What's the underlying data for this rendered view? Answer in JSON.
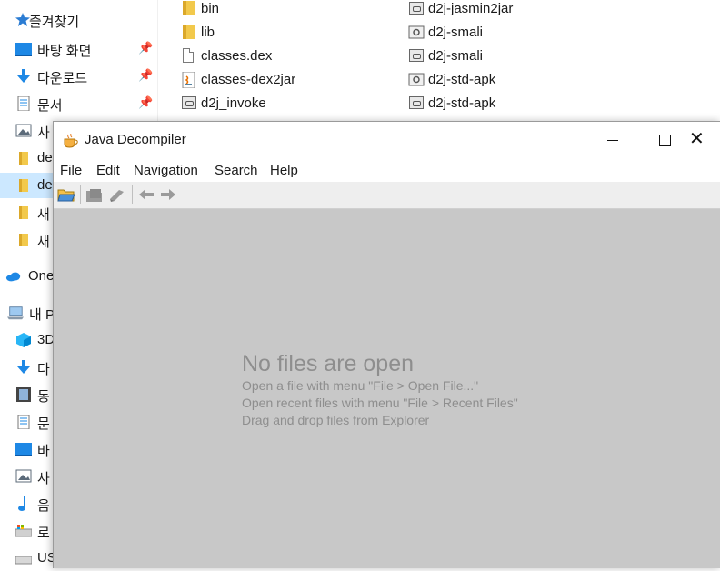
{
  "explorer": {
    "nav": [
      {
        "label": "즐겨찾기",
        "icon": "star-icon",
        "pinned": false,
        "selected": false
      },
      {
        "label": "바탕 화면",
        "icon": "desktop-icon",
        "pinned": true,
        "selected": false
      },
      {
        "label": "다운로드",
        "icon": "download-arrow-icon",
        "pinned": true,
        "selected": false
      },
      {
        "label": "문서",
        "icon": "document-icon",
        "pinned": true,
        "selected": false
      },
      {
        "label": "사",
        "icon": "pictures-icon",
        "pinned": false,
        "selected": false
      },
      {
        "label": "de",
        "icon": "folder-icon",
        "pinned": false,
        "selected": false
      },
      {
        "label": "de",
        "icon": "folder-icon",
        "pinned": false,
        "selected": true
      },
      {
        "label": "새",
        "icon": "folder-icon",
        "pinned": false,
        "selected": false
      },
      {
        "label": "새",
        "icon": "folder-icon",
        "pinned": false,
        "selected": false
      },
      {
        "label": "One",
        "icon": "onedrive-cloud-icon",
        "pinned": false,
        "selected": false
      },
      {
        "label": "내 P",
        "icon": "pc-icon",
        "pinned": false,
        "selected": false
      },
      {
        "label": "3D",
        "icon": "3d-objects-icon",
        "pinned": false,
        "selected": false
      },
      {
        "label": "다",
        "icon": "download-arrow-icon",
        "pinned": false,
        "selected": false
      },
      {
        "label": "동",
        "icon": "video-icon",
        "pinned": false,
        "selected": false
      },
      {
        "label": "문",
        "icon": "document-icon",
        "pinned": false,
        "selected": false
      },
      {
        "label": "바",
        "icon": "desktop-icon",
        "pinned": false,
        "selected": false
      },
      {
        "label": "사",
        "icon": "pictures-icon",
        "pinned": false,
        "selected": false
      },
      {
        "label": "음",
        "icon": "music-note-icon",
        "pinned": false,
        "selected": false
      },
      {
        "label": "로",
        "icon": "local-disk-icon",
        "pinned": false,
        "selected": false
      },
      {
        "label": "US",
        "icon": "usb-drive-icon",
        "pinned": false,
        "selected": false
      }
    ],
    "files_col1": [
      {
        "label": "bin",
        "icon": "folder-icon"
      },
      {
        "label": "lib",
        "icon": "folder-icon"
      },
      {
        "label": "classes.dex",
        "icon": "file-icon"
      },
      {
        "label": "classes-dex2jar",
        "icon": "java-jar-icon"
      },
      {
        "label": "d2j_invoke",
        "icon": "cmd-file-icon"
      }
    ],
    "files_col2": [
      {
        "label": "d2j-jasmin2jar",
        "icon": "cmd-file-icon"
      },
      {
        "label": "d2j-smali",
        "icon": "gear-file-icon"
      },
      {
        "label": "d2j-smali",
        "icon": "cmd-file-icon"
      },
      {
        "label": "d2j-std-apk",
        "icon": "gear-file-icon"
      },
      {
        "label": "d2j-std-apk",
        "icon": "cmd-file-icon"
      }
    ]
  },
  "window": {
    "title": "Java Decompiler",
    "menu": [
      "File",
      "Edit",
      "Navigation",
      "Search",
      "Help"
    ],
    "close_glyph": "✕"
  },
  "content": {
    "title": "No files are open",
    "lines": [
      "Open a file with menu \"File > Open File...\"",
      "Open recent files with menu \"File > Recent Files\"",
      "Drag and drop files from Explorer"
    ]
  },
  "colors": {
    "accent": "#2b7cd3",
    "selected_nav": "#cce8ff",
    "content_bg": "#c8c8c8",
    "hint_text": "#8e8e8e"
  }
}
